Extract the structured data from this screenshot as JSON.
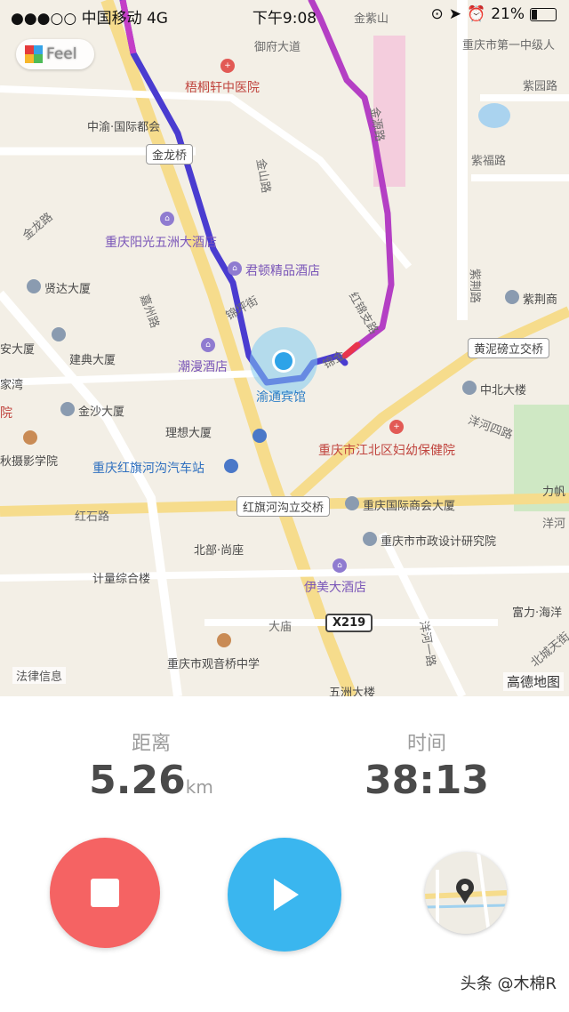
{
  "status_bar": {
    "carrier": "●●●○○ 中国移动",
    "network": "4G",
    "time": "下午9:08",
    "battery": "21%"
  },
  "feel_badge": {
    "label": "Feel"
  },
  "map": {
    "attribution": "高德地图",
    "legal": "法律信息",
    "labels": {
      "jinzishan": "金紫山",
      "yufu": "御府大道",
      "wutong": "梧桐轩中医院",
      "diyizhong": "重庆市第一中级人",
      "zhongyu": "中渝·国际都会",
      "jinyuanlu": "金源路",
      "zijinglu_top": "紫园路",
      "zhongyuanlu": "紫福路",
      "zijinglu2": "紫福路",
      "jinlongqiao": "金龙桥",
      "jinshanlu": "金山路",
      "jinlonglu": "金龙路",
      "yangguang": "重庆阳光五洲大酒店",
      "junrun": "君顿精品酒店",
      "zijing": "紫荆路",
      "zijingshang": "紫荆商",
      "xianda": "贤达大厦",
      "jiazhou": "嘉州路",
      "jinping": "锦坪街",
      "hongjin": "红锦支路",
      "an": "安大厦",
      "jiandian": "建典大厦",
      "chaoman": "潮漫酒店",
      "jinjin": "锦金",
      "huangnibang": "黄泥磅立交桥",
      "jiawan": "家湾",
      "yutong": "渝通宾馆",
      "zhongbei": "中北大楼",
      "yuan": "院",
      "jinsha": "金沙大厦",
      "lixiang": "理想大厦",
      "jiangbei": "重庆市江北区妇幼保健院",
      "yangkou": "洋河四路",
      "qiusheying": "秋摄影学院",
      "hongqihe": "重庆红旗河沟汽车站",
      "lifan": "力帆",
      "hongshilu": "红石路",
      "hongqiliqiao": "红旗河沟立交桥",
      "guojishanghui": "重庆国际商会大厦",
      "yang": "洋河",
      "beibu": "北部·尚座",
      "shizheng": "重庆市市政设计研究院",
      "jiliang": "计量综合楼",
      "yimei": "伊美大酒店",
      "fuli": "富力·海洋",
      "damiao": "大庙",
      "x219": "X219",
      "yanghe1": "洋河一路",
      "beicheng": "北城天街",
      "guanyin": "重庆市观音桥中学",
      "wuzhou": "五洲大楼"
    }
  },
  "stats": {
    "distance_caption": "距离",
    "distance_value": "5.26",
    "distance_unit": "km",
    "time_caption": "时间",
    "time_value": "38:13"
  },
  "controls": {
    "stop_icon": "stop-icon",
    "play_icon": "play-icon",
    "map_icon": "map-thumbnail-icon"
  },
  "watermark": "头条 @木棉R"
}
